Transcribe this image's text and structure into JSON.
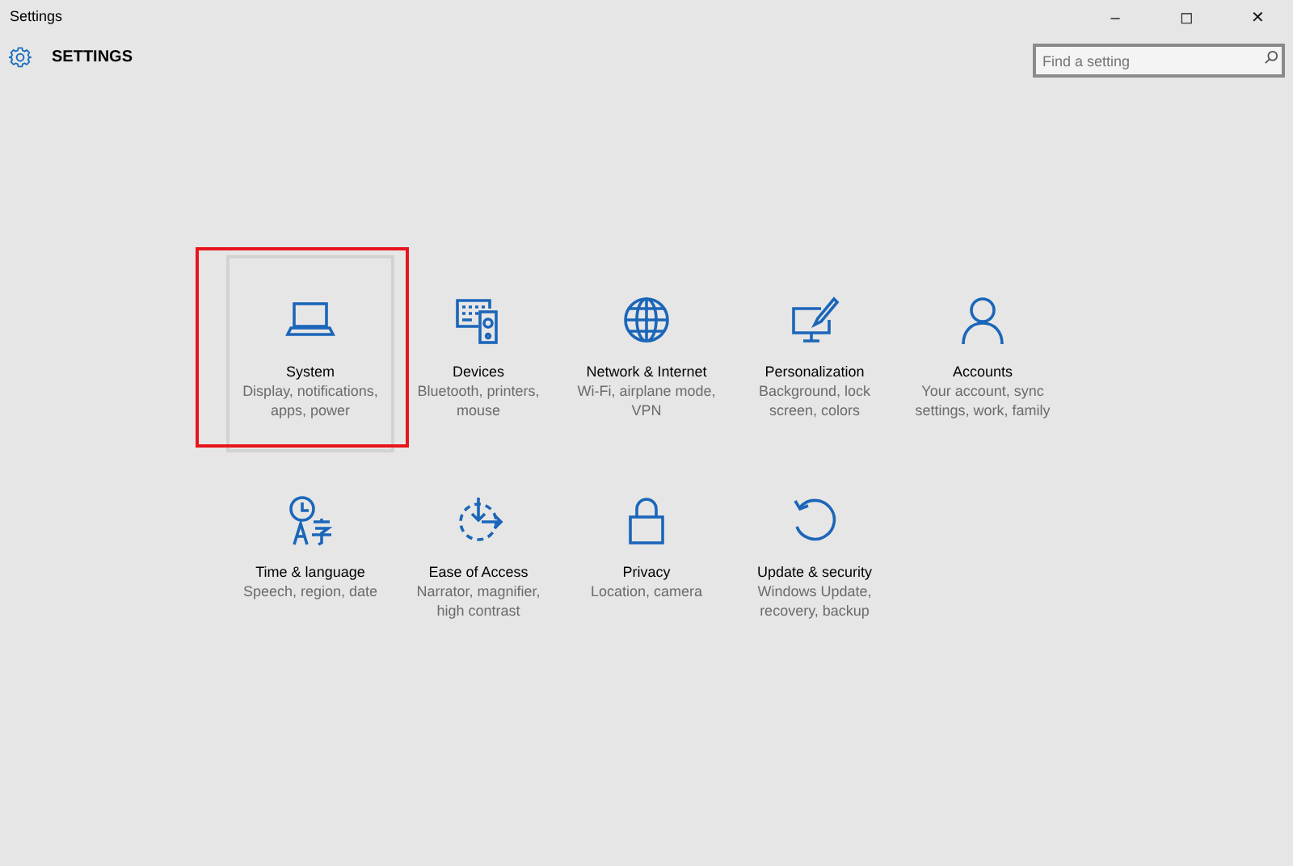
{
  "window": {
    "title": "Settings",
    "controls": [
      "–",
      "◻",
      "✕"
    ]
  },
  "header": {
    "title": "SETTINGS"
  },
  "search": {
    "placeholder": "Find a setting"
  },
  "tiles": [
    {
      "kind": "laptop",
      "title": "System",
      "subtitle": "Display, notifications, apps, power",
      "selected": true,
      "highlighted": true
    },
    {
      "kind": "devices",
      "title": "Devices",
      "subtitle": "Bluetooth, printers, mouse",
      "selected": false,
      "highlighted": false
    },
    {
      "kind": "globe",
      "title": "Network & Internet",
      "subtitle": "Wi-Fi, airplane mode, VPN",
      "selected": false,
      "highlighted": false
    },
    {
      "kind": "paint",
      "title": "Personalization",
      "subtitle": "Background, lock screen, colors",
      "selected": false,
      "highlighted": false
    },
    {
      "kind": "person",
      "title": "Accounts",
      "subtitle": "Your account, sync settings, work, family",
      "selected": false,
      "highlighted": false
    },
    {
      "kind": "clock",
      "title": "Time & language",
      "subtitle": "Speech, region, date",
      "selected": false,
      "highlighted": false
    },
    {
      "kind": "access",
      "title": "Ease of Access",
      "subtitle": "Narrator, magnifier, high contrast",
      "selected": false,
      "highlighted": false
    },
    {
      "kind": "lock",
      "title": "Privacy",
      "subtitle": "Location, camera",
      "selected": false,
      "highlighted": false
    },
    {
      "kind": "update",
      "title": "Update & security",
      "subtitle": "Windows Update, recovery, backup",
      "selected": false,
      "highlighted": false
    }
  ]
}
